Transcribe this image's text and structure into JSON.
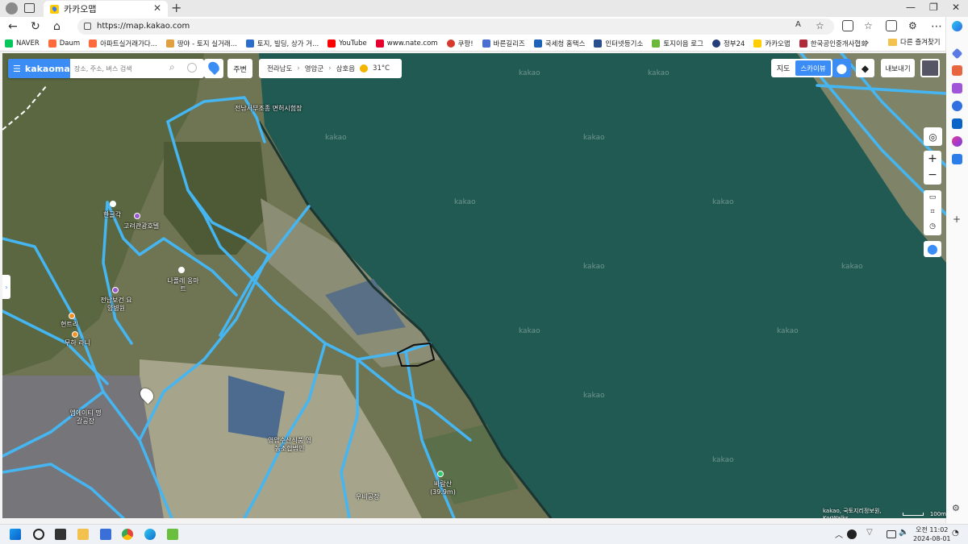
{
  "browser": {
    "tab_title": "카카오맵",
    "url": "https://map.kakao.com"
  },
  "bookmarks": [
    {
      "label": "NAVER",
      "color": "#03c75a"
    },
    {
      "label": "Daum",
      "color": "#ff6a3d"
    },
    {
      "label": "아파트실거래가다...",
      "color": "#ff6a3d"
    },
    {
      "label": "땅야 - 토지 실거래...",
      "color": "#e0a040"
    },
    {
      "label": "토지, 빌딩, 상가 거...",
      "color": "#2c6ecb"
    },
    {
      "label": "YouTube",
      "color": "#ff0000"
    },
    {
      "label": "www.nate.com",
      "color": "#e6002d"
    },
    {
      "label": "쿠팡!",
      "color": "#d63a2f"
    },
    {
      "label": "바른길리즈",
      "color": "#4a6fd1"
    },
    {
      "label": "국세청 홈택스",
      "color": "#1c63b8"
    },
    {
      "label": "인터넷등기소",
      "color": "#2a4f8f"
    },
    {
      "label": "토지이음 로그",
      "color": "#6bb83a"
    },
    {
      "label": "정부24",
      "color": "#253d7a"
    },
    {
      "label": "카카오맵",
      "color": "#ffcd00"
    },
    {
      "label": "한국공인중개사협회",
      "color": "#b02a37"
    }
  ],
  "bookmarks_more": "다른 즐겨찾기",
  "map": {
    "logo": "kakaomap",
    "search_placeholder": "장소, 주소, 버스 검색",
    "nearby": "주변",
    "breadcrumb": [
      "전라남도",
      "영암군",
      "삼호읍"
    ],
    "weather": "31°C",
    "map_type": "지도",
    "skyview": "스카이뷰",
    "export": "내보내기",
    "watermark": "kakao",
    "attribution": "kakao, 국토지리정보원, KorWalks",
    "scale": "100m",
    "pois": [
      {
        "name": "전남서부조종 면허시험장"
      },
      {
        "name": "한글각"
      },
      {
        "name": "고려관광호텔"
      },
      {
        "name": "나폴레 옹마트"
      },
      {
        "name": "전남보건 요양병원"
      },
      {
        "name": "현트리"
      },
      {
        "name": "무하 라니"
      },
      {
        "name": "엠에이티 명갈공장"
      },
      {
        "name": "영암수산식품 영농조합법인"
      },
      {
        "name": "바람산 (39.9m)"
      },
      {
        "name": "우비공장"
      }
    ]
  },
  "taskbar": {
    "time": "오전 11:02",
    "date": "2024-08-01"
  }
}
